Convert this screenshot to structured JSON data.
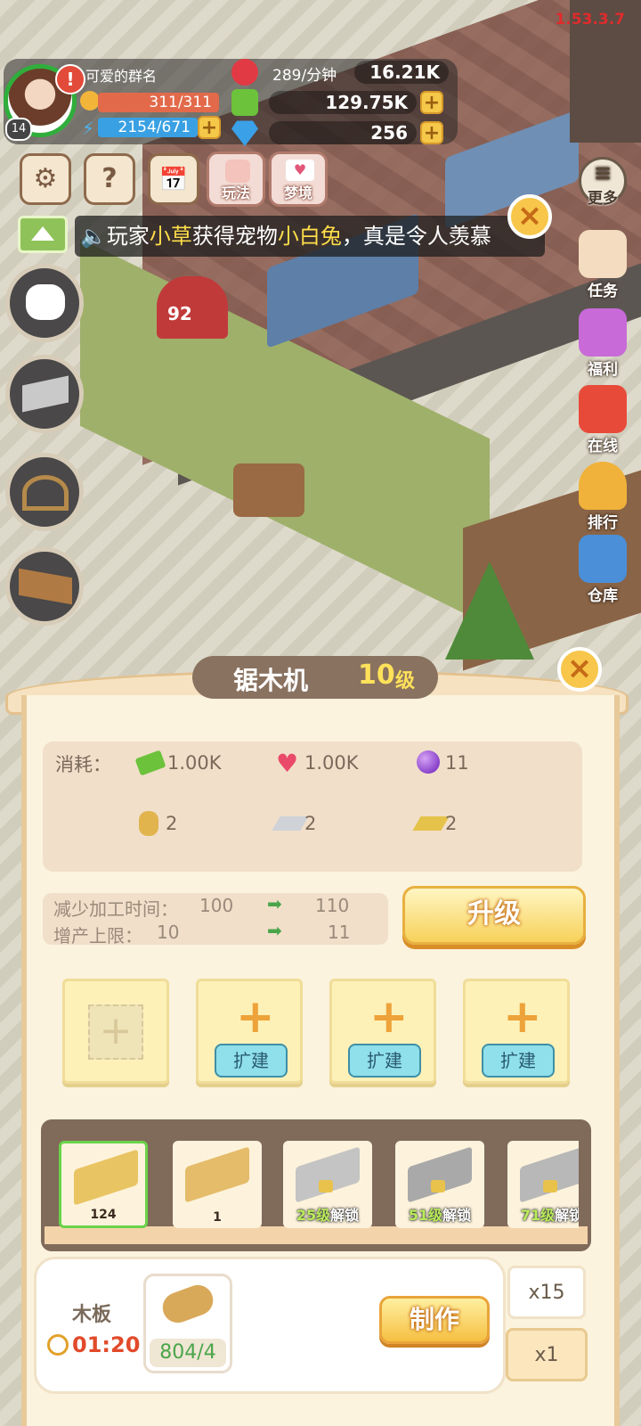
{
  "status_bar": {
    "version": "1.53.3.7"
  },
  "player": {
    "name": "可爱的群名",
    "level": "14",
    "stamina": "311/311",
    "energy": "2154/671"
  },
  "resources": {
    "hearts_rate": "289/分钟",
    "hearts": "16.21K",
    "cash": "129.75K",
    "gems": "256"
  },
  "top_buttons": {
    "play_label": "玩法",
    "dream_label": "梦境"
  },
  "marquee": {
    "prefix": "玩家",
    "player": "小草",
    "mid": "获得宠物",
    "pet": "小白兔",
    "suffix": "，真是令人羡慕"
  },
  "side_menu": [
    {
      "label": "更多",
      "icon": "list-icon"
    },
    {
      "label": "任务",
      "icon": "scroll-icon"
    },
    {
      "label": "福利",
      "icon": "gift-icon"
    },
    {
      "label": "在线",
      "icon": "clock-gift-icon"
    },
    {
      "label": "排行",
      "icon": "trophy-icon"
    },
    {
      "label": "仓库",
      "icon": "warehouse-icon"
    }
  ],
  "scene": {
    "mailbox_number": "92"
  },
  "machine": {
    "title": "锯木机",
    "level_num": "10",
    "level_unit": "级",
    "cost_label": "消耗：",
    "costs": [
      {
        "icon": "cash-icon",
        "value": "1.00K"
      },
      {
        "icon": "heart-icon",
        "value": "1.00K"
      },
      {
        "icon": "purple-orb-icon",
        "value": "11"
      },
      {
        "icon": "rope-icon",
        "value": "2"
      },
      {
        "icon": "silver-ingot-icon",
        "value": "2"
      },
      {
        "icon": "gold-ingot-icon",
        "value": "2"
      }
    ],
    "stats": [
      {
        "label": "减少加工时间：",
        "from": "100",
        "to": "110"
      },
      {
        "label": "增产上限：",
        "from": "10",
        "to": "11"
      }
    ],
    "upgrade_label": "升级",
    "expand_label": "扩建",
    "products": [
      {
        "count": "124",
        "locked": false,
        "selected": true
      },
      {
        "count": "1",
        "locked": false,
        "selected": false
      },
      {
        "unlock_level": "25级",
        "unlock_text": "解锁",
        "locked": true
      },
      {
        "unlock_level": "51级",
        "unlock_text": "解锁",
        "locked": true
      },
      {
        "unlock_level": "71级",
        "unlock_text": "解锁",
        "locked": true
      }
    ],
    "craft": {
      "product_name": "木板",
      "time": "01:20",
      "material_amount": "804/4",
      "make_label": "制作",
      "multipliers": [
        "x15",
        "x1"
      ]
    }
  }
}
